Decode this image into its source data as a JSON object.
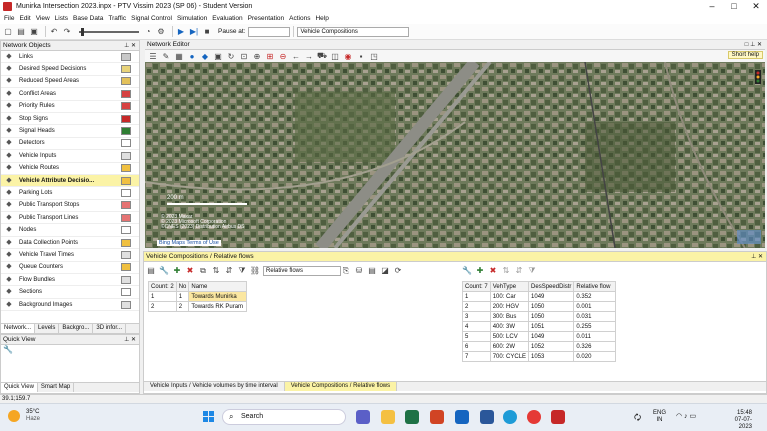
{
  "window": {
    "title": "Munirka Intersection 2023.inpx - PTV Vissim 2023 (SP 06) - Student Version",
    "controls": [
      "–",
      "□",
      "✕"
    ]
  },
  "menu": [
    "File",
    "Edit",
    "View",
    "Lists",
    "Base Data",
    "Traffic",
    "Signal Control",
    "Simulation",
    "Evaluation",
    "Presentation",
    "Actions",
    "Help"
  ],
  "toolbar": {
    "pause_label": "Pause at:",
    "pause_value": "",
    "list_select": "Vehicle Compositions"
  },
  "network_objects": {
    "title": "Network Objects",
    "items": [
      {
        "label": "Links",
        "icon": "links-icon",
        "color": "#c8c8c8"
      },
      {
        "label": "Desired Speed Decisions",
        "icon": "speed-icon",
        "color": "#e8d37a"
      },
      {
        "label": "Reduced Speed Areas",
        "icon": "reduced-speed-icon",
        "color": "#e3c15a"
      },
      {
        "label": "Conflict Areas",
        "icon": "conflict-icon",
        "color": "#d64242"
      },
      {
        "label": "Priority Rules",
        "icon": "priority-icon",
        "color": "#d64242"
      },
      {
        "label": "Stop Signs",
        "icon": "stop-sign-icon",
        "color": "#c62828"
      },
      {
        "label": "Signal Heads",
        "icon": "signal-icon",
        "color": "#2e7d32"
      },
      {
        "label": "Detectors",
        "icon": "detector-icon",
        "color": "#ffffff"
      },
      {
        "label": "Vehicle Inputs",
        "icon": "vehicle-input-icon",
        "color": "#e0e0e0"
      },
      {
        "label": "Vehicle Routes",
        "icon": "route-icon",
        "color": "#f0c040"
      },
      {
        "label": "Vehicle Attribute Decisio...",
        "icon": "attribute-icon",
        "color": "#f0c040",
        "selected": true
      },
      {
        "label": "Parking Lots",
        "icon": "parking-icon",
        "color": "#ffffff"
      },
      {
        "label": "Public Transport Stops",
        "icon": "pt-stop-icon",
        "color": "#e57373"
      },
      {
        "label": "Public Transport Lines",
        "icon": "pt-line-icon",
        "color": "#e57373"
      },
      {
        "label": "Nodes",
        "icon": "nodes-icon",
        "color": "#ffffff"
      },
      {
        "label": "Data Collection Points",
        "icon": "data-point-icon",
        "color": "#f0c040"
      },
      {
        "label": "Vehicle Travel Times",
        "icon": "travel-time-icon",
        "color": "#e0e0e0"
      },
      {
        "label": "Queue Counters",
        "icon": "queue-icon",
        "color": "#f0c040"
      },
      {
        "label": "Flow Bundles",
        "icon": "flow-icon",
        "color": "#e0e0e0"
      },
      {
        "label": "Sections",
        "icon": "sections-icon",
        "color": "#ffffff"
      },
      {
        "label": "Background Images",
        "icon": "image-icon",
        "color": "#e0e0e0"
      }
    ],
    "tabs": [
      "Network...",
      "Levels",
      "Backgro...",
      "3D infor..."
    ]
  },
  "quick_view": {
    "title": "Quick View",
    "tabs": [
      "Quick View",
      "Smart Map"
    ]
  },
  "network_editor": {
    "title": "Network Editor",
    "short_help": "Short help",
    "scale_label": "200 m",
    "copyright": [
      "© 2023 Maxar",
      "© 2023 Microsoft Corporation",
      "©CNES (2023) Distribution Airbus DS"
    ],
    "links": "Bing Maps Terms of Use"
  },
  "compositions_panel": {
    "title": "Vehicle Compositions / Relative flows",
    "list_select": "Relative flows",
    "left_columns": [
      "Count: 2",
      "No",
      "Name"
    ],
    "left_rows": [
      [
        "1",
        "1",
        "Towards Munirka"
      ],
      [
        "2",
        "2",
        "Towards RK Puram"
      ]
    ],
    "right_columns": [
      "Count: 7",
      "VehType",
      "DesSpeedDistr",
      "Relative flow"
    ],
    "right_rows": [
      [
        "1",
        "100: Car",
        "1049",
        "0.352"
      ],
      [
        "2",
        "200: HGV",
        "1050",
        "0.001"
      ],
      [
        "3",
        "300: Bus",
        "1050",
        "0.031"
      ],
      [
        "4",
        "400: 3W",
        "1051",
        "0.255"
      ],
      [
        "5",
        "500: LCV",
        "1049",
        "0.011"
      ],
      [
        "6",
        "600: 2W",
        "1052",
        "0.326"
      ],
      [
        "7",
        "700: CYCLE",
        "1053",
        "0.020"
      ]
    ],
    "bottom_tabs": [
      "Vehicle Inputs / Vehicle volumes by time interval",
      "Vehicle Compositions / Relative flows"
    ]
  },
  "status": {
    "coords": "39.1;159.7"
  },
  "taskbar": {
    "weather_temp": "35°C",
    "weather_desc": "Haze",
    "search_label": "Search",
    "lang": "ENG",
    "region": "IN",
    "time": "15:48",
    "date": "07-07-2023"
  }
}
